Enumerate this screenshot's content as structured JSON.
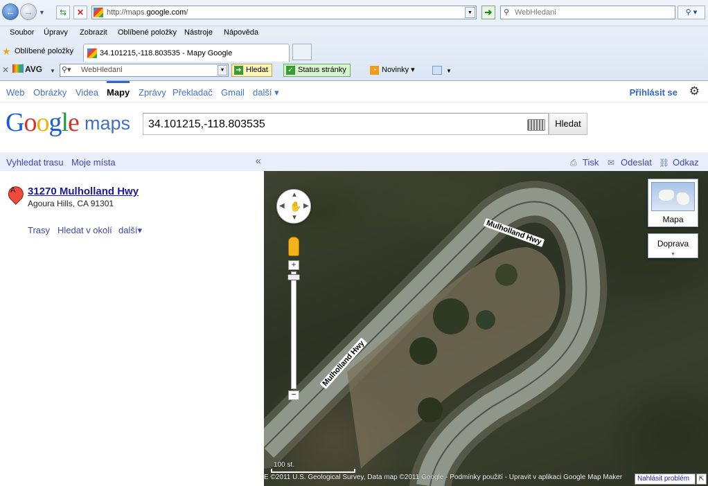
{
  "browser": {
    "url_prefix": "http://maps.",
    "url_domain": "google.com",
    "url_suffix": "/",
    "search_placeholder": "WebHledani",
    "menu": [
      "Soubor",
      "Úpravy",
      "Zobrazit",
      "Oblíbené položky",
      "Nástroje",
      "Nápověda"
    ],
    "favorites_label": "Oblíbené položky",
    "tab_title": "34.101215,-118.803535 - Mapy Google",
    "toolbar": {
      "brand": "AVG",
      "search_text": "WebHledani",
      "hledat": "Hledat",
      "status": "Status stránky",
      "novinky": "Novinky"
    }
  },
  "google_nav": {
    "links": [
      "Web",
      "Obrázky",
      "Videa",
      "Mapy",
      "Zprávy",
      "Překladač",
      "Gmail",
      "další ▾"
    ],
    "active": "Mapy",
    "signin": "Přihlásit se"
  },
  "logo": {
    "word": "Google",
    "product": "maps"
  },
  "search": {
    "query": "34.101215,-118.803535",
    "button": "Hledat"
  },
  "left_panel": {
    "tabs": [
      "Vyhledat trasu",
      "Moje místa"
    ],
    "collapse_glyph": "«",
    "result": {
      "marker": "A",
      "title": "31270 Mulholland Hwy",
      "address": "Agoura Hills, CA 91301",
      "links": [
        "Trasy",
        "Hledat v okolí",
        "další▾"
      ]
    }
  },
  "map_header": {
    "print": "Tisk",
    "send": "Odeslat",
    "link": "Odkaz"
  },
  "map": {
    "type_button": "Mapa",
    "traffic_button": "Doprava",
    "road_labels": [
      "Mulholland Hwy",
      "Mulholland Hwy"
    ],
    "scale": "100 st.",
    "attribution": "E ©2011 U.S. Geological Survey, Data map ©2011 Google - Podmínky použití - Upravit v aplikaci Google Map Maker",
    "report": "Nahlásit problém",
    "road_color": "#8f978a"
  }
}
